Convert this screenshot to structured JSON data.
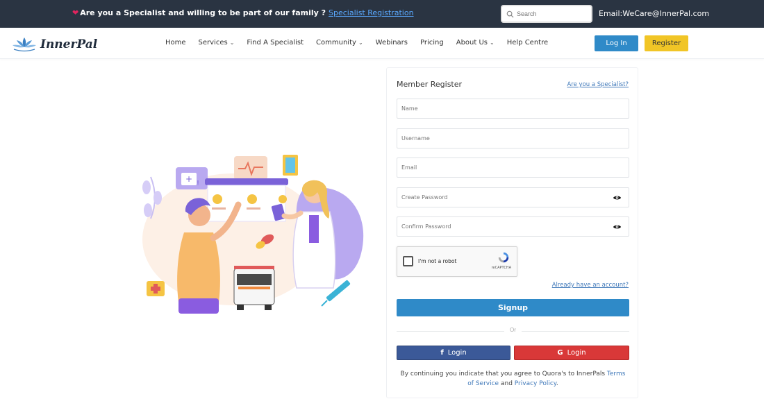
{
  "topbar": {
    "promo_text": "Are you a Specialist and willing to be part of our family ?",
    "promo_link": "Specialist Registration",
    "search_placeholder": "Search",
    "email": "Email:WeCare@InnerPal.com"
  },
  "brand": {
    "name": "InnerPal"
  },
  "nav": {
    "items": [
      {
        "label": "Home",
        "dropdown": false
      },
      {
        "label": "Services",
        "dropdown": true
      },
      {
        "label": "Find A Specialist",
        "dropdown": false
      },
      {
        "label": "Community",
        "dropdown": true
      },
      {
        "label": "Webinars",
        "dropdown": false
      },
      {
        "label": "Pricing",
        "dropdown": false
      },
      {
        "label": "About Us",
        "dropdown": true
      },
      {
        "label": "Help Centre",
        "dropdown": false
      }
    ],
    "login_label": "Log In",
    "register_label": "Register"
  },
  "form": {
    "title": "Member Register",
    "specialist_link": "Are you a Specialist?",
    "fields": {
      "name_placeholder": "Name",
      "username_placeholder": "Username",
      "email_placeholder": "Email",
      "password_placeholder": "Create Password",
      "confirm_placeholder": "Confirm Password"
    },
    "captcha_label": "I'm not a robot",
    "captcha_brand": "reCAPTCHA",
    "already_link": "Already have an account?",
    "signup_label": "Signup",
    "or_label": "Or",
    "facebook_login": "Login",
    "google_login": "Login",
    "terms_prefix": "By continuing you indicate that you agree to Quora's to InnerPals",
    "terms_link": "Terms of Service",
    "terms_and": "and",
    "privacy_link": "Privacy Policy",
    "terms_suffix": "."
  },
  "colors": {
    "topbar_bg": "#2a3442",
    "primary": "#2f8ac8",
    "accent": "#f1c526",
    "facebook": "#3b5998",
    "google": "#d93838",
    "link": "#3f78b9"
  },
  "icons": [
    "heart-icon",
    "search-icon",
    "lotus-logo-icon",
    "chevron-down-icon",
    "eye-icon",
    "recaptcha-icon",
    "facebook-icon",
    "google-icon"
  ]
}
